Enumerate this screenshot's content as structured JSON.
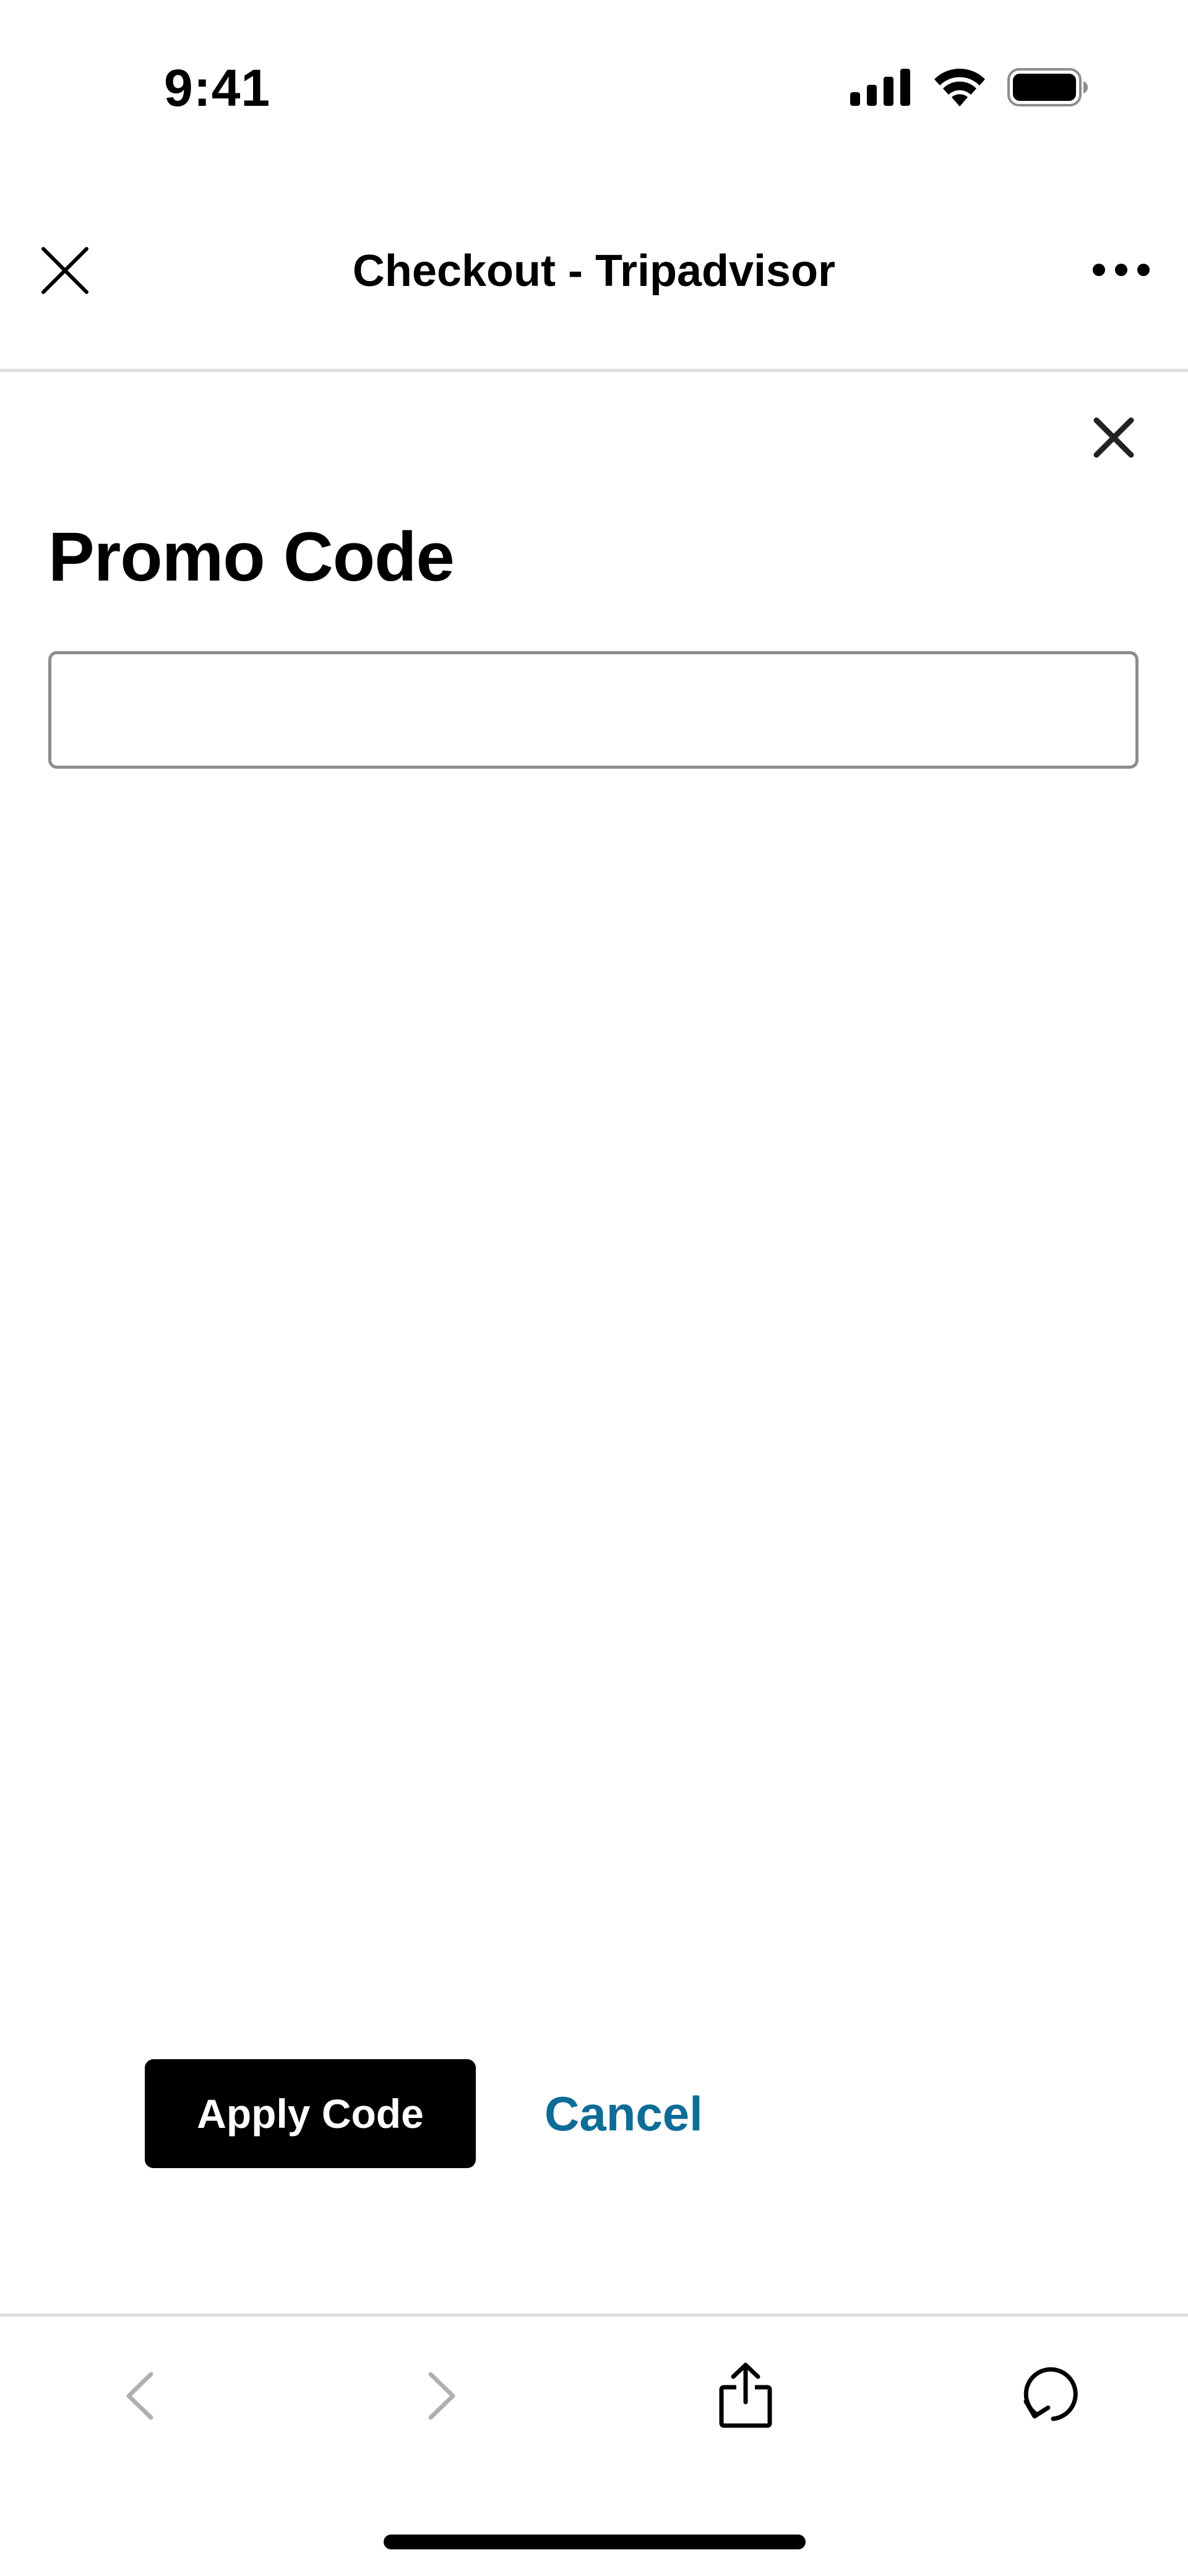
{
  "status_bar": {
    "time": "9:41",
    "icons": [
      "signal-icon",
      "wifi-icon",
      "battery-icon"
    ]
  },
  "browser_header": {
    "title": "Checkout - Tripadvisor",
    "close_icon": "close-icon",
    "more_icon": "more-icon"
  },
  "promo_modal": {
    "title": "Promo Code",
    "input_value": "",
    "apply_label": "Apply Code",
    "cancel_label": "Cancel",
    "close_icon": "close-icon"
  },
  "toolbar": {
    "icons": [
      "back-icon",
      "forward-icon",
      "share-icon",
      "reload-icon"
    ]
  },
  "colors": {
    "accent_link": "#0e6c97",
    "primary_button": "#000000",
    "input_border": "#8c8c8c",
    "divider": "#dedede",
    "disabled_icon": "#b0b0b0"
  }
}
